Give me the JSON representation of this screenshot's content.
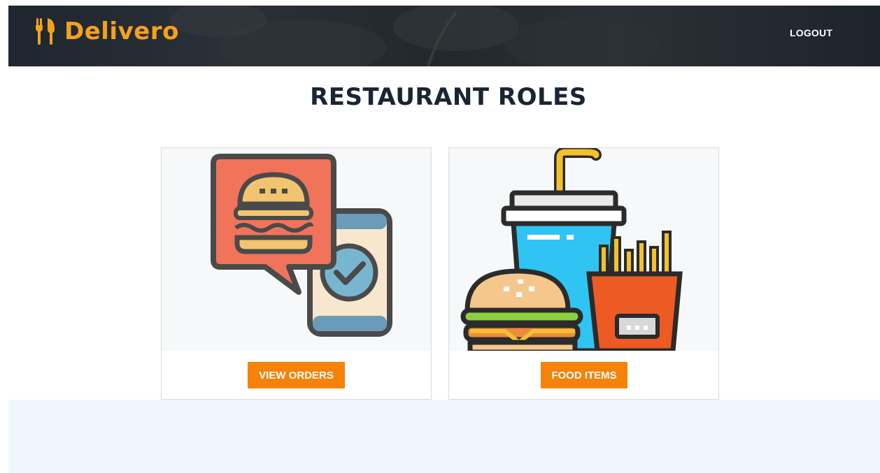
{
  "header": {
    "brand": "Delivero",
    "logout_label": "LOGOUT"
  },
  "main": {
    "title": "RESTAURANT ROLES",
    "cards": [
      {
        "button_label": "VIEW ORDERS",
        "image": "burger-chat-phone-illustration"
      },
      {
        "button_label": "FOOD ITEMS",
        "image": "fast-food-meal-illustration"
      }
    ]
  },
  "colors": {
    "brand": "#f5a11c",
    "button": "#f5820b",
    "title": "#1b2433",
    "footer": "#f0f6fd"
  }
}
